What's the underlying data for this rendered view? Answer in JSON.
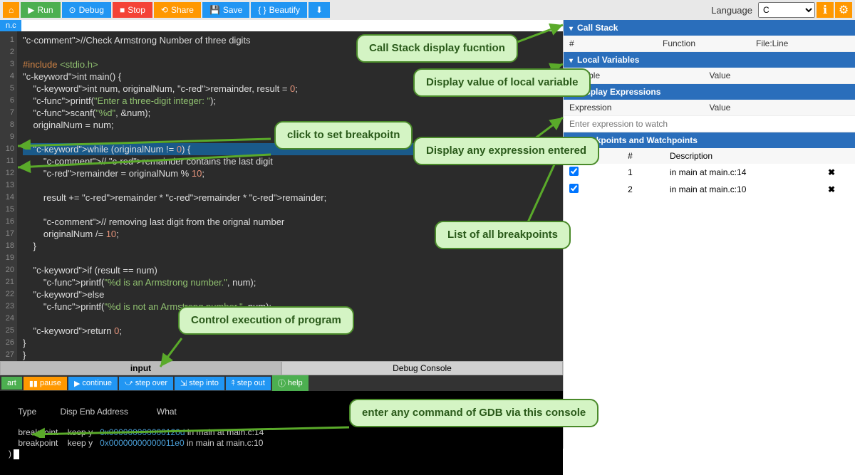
{
  "toolbar": {
    "run": "Run",
    "debug": "Debug",
    "stop": "Stop",
    "share": "Share",
    "save": "Save",
    "beautify": "Beautify",
    "language_label": "Language",
    "language_value": "C"
  },
  "filetab": "n.c",
  "code_lines": [
    "//Check Armstrong Number of three digits",
    "",
    "#include <stdio.h>",
    "int main() {",
    "    int num, originalNum, remainder, result = 0;",
    "    printf(\"Enter a three-digit integer: \");",
    "    scanf(\"%d\", &num);",
    "    originalNum = num;",
    "",
    "    while (originalNum != 0) {",
    "        // remainder contains the last digit",
    "        remainder = originalNum % 10;",
    "        ",
    "        result += remainder * remainder * remainder;",
    "        ",
    "        // removing last digit from the orignal number",
    "        originalNum /= 10;",
    "    }",
    "",
    "    if (result == num)",
    "        printf(\"%d is an Armstrong number.\", num);",
    "    else",
    "        printf(\"%d is not an Armstrong number.\", num);",
    "",
    "    return 0;",
    "}",
    "}"
  ],
  "tabs": {
    "input": "input",
    "debug_console": "Debug Console"
  },
  "debug_bar": {
    "start": "art",
    "pause": "pause",
    "continue": "continue",
    "step_over": "step over",
    "step_into": "step into",
    "step_out": "step out",
    "help": "help"
  },
  "console": {
    "header": "    Type          Disp Enb Address            What",
    "line1a": "    breakpoint    keep y   ",
    "line1b": "0x000000000000120d",
    "line1c": " in main at main.c:14",
    "line2a": "    breakpoint    keep y   ",
    "line2b": "0x00000000000011e0",
    "line2c": " in main at main.c:10",
    "prompt": ") "
  },
  "panels": {
    "call_stack": {
      "title": "Call Stack",
      "cols": [
        "#",
        "Function",
        "File:Line"
      ]
    },
    "locals": {
      "title": "Local Variables",
      "cols": [
        "Variable",
        "Value"
      ]
    },
    "expressions": {
      "title": "Display Expressions",
      "cols": [
        "Expression",
        "Value"
      ],
      "placeholder": "Enter expression to watch"
    },
    "breakpoints": {
      "title": "Breakpoints and Watchpoints",
      "cols": [
        "",
        "#",
        "Description",
        ""
      ],
      "rows": [
        {
          "checked": true,
          "num": "1",
          "desc": "in main at main.c:14"
        },
        {
          "checked": true,
          "num": "2",
          "desc": "in main at main.c:10"
        }
      ]
    }
  },
  "callouts": {
    "breakpoint": "click to set breakpoitn",
    "callstack": "Call Stack display fucntion",
    "locals": "Display value of local variable",
    "expressions": "Display any expression entered",
    "bplist": "List of all breakpoints",
    "control": "Control execution of program",
    "gdb": "enter any command of GDB via this console"
  }
}
